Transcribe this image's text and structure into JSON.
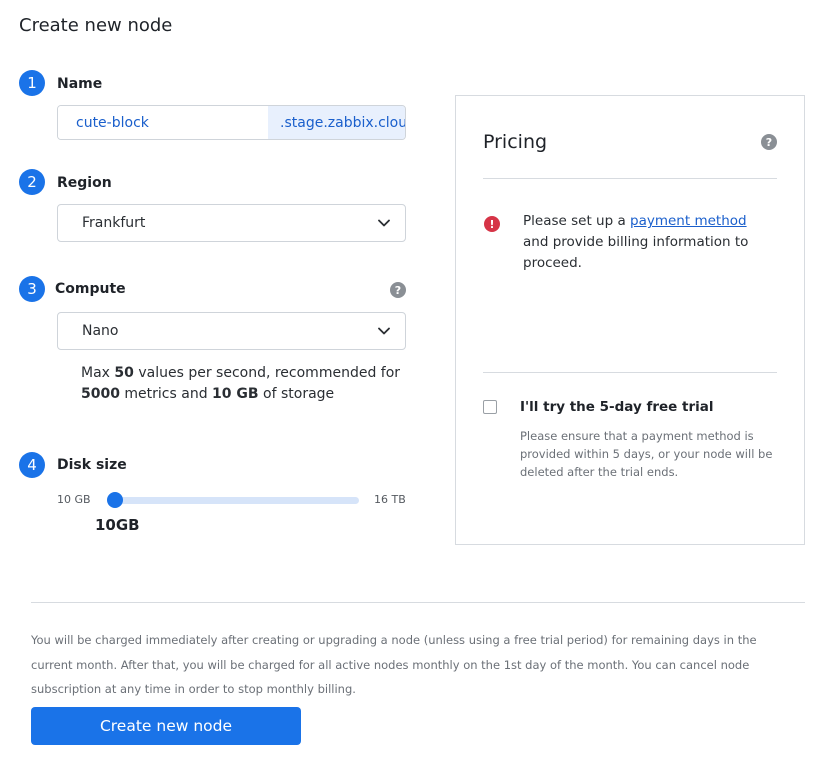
{
  "page": {
    "title": "Create new node"
  },
  "steps": {
    "name": {
      "number": "1",
      "label": "Name",
      "value": "cute-block",
      "suffix": ".stage.zabbix.cloud"
    },
    "region": {
      "number": "2",
      "label": "Region",
      "selected": "Frankfurt"
    },
    "compute": {
      "number": "3",
      "label": "Compute",
      "selected": "Nano",
      "help": "?",
      "desc": {
        "p1": "Max ",
        "values": "50",
        "p2": " values per second, recommended for ",
        "metrics": "5000",
        "p3": " metrics and ",
        "storage": "10 GB",
        "p4": " of storage"
      }
    },
    "disk": {
      "number": "4",
      "label": "Disk size",
      "min_label": "10 GB",
      "max_label": "16 TB",
      "value_label": "10GB",
      "fraction": 0.0
    }
  },
  "pricing": {
    "title": "Pricing",
    "help": "?",
    "alert": {
      "icon": "!",
      "p1": "Please set up a ",
      "link": "payment method",
      "p2": " and provide billing information to proceed."
    },
    "trial": {
      "checked": false,
      "label": "I'll try the 5-day free trial",
      "note": "Please ensure that a payment method is provided within 5 days, or your node will be deleted after the trial ends."
    }
  },
  "footer": {
    "note": "You will be charged immediately after creating or upgrading a node (unless using a free trial period) for remaining days in the current month. After that, you will be charged for all active nodes monthly on the 1st day of the month. You can cancel node subscription at any time in order to stop monthly billing.",
    "button_label": "Create new node"
  },
  "colors": {
    "accent": "#1a73e8",
    "error": "#d63447",
    "link": "#1a5fcc"
  },
  "icons": {
    "chevron": "chevron-down-icon",
    "help": "question-icon",
    "alert": "alert-circle-icon"
  }
}
